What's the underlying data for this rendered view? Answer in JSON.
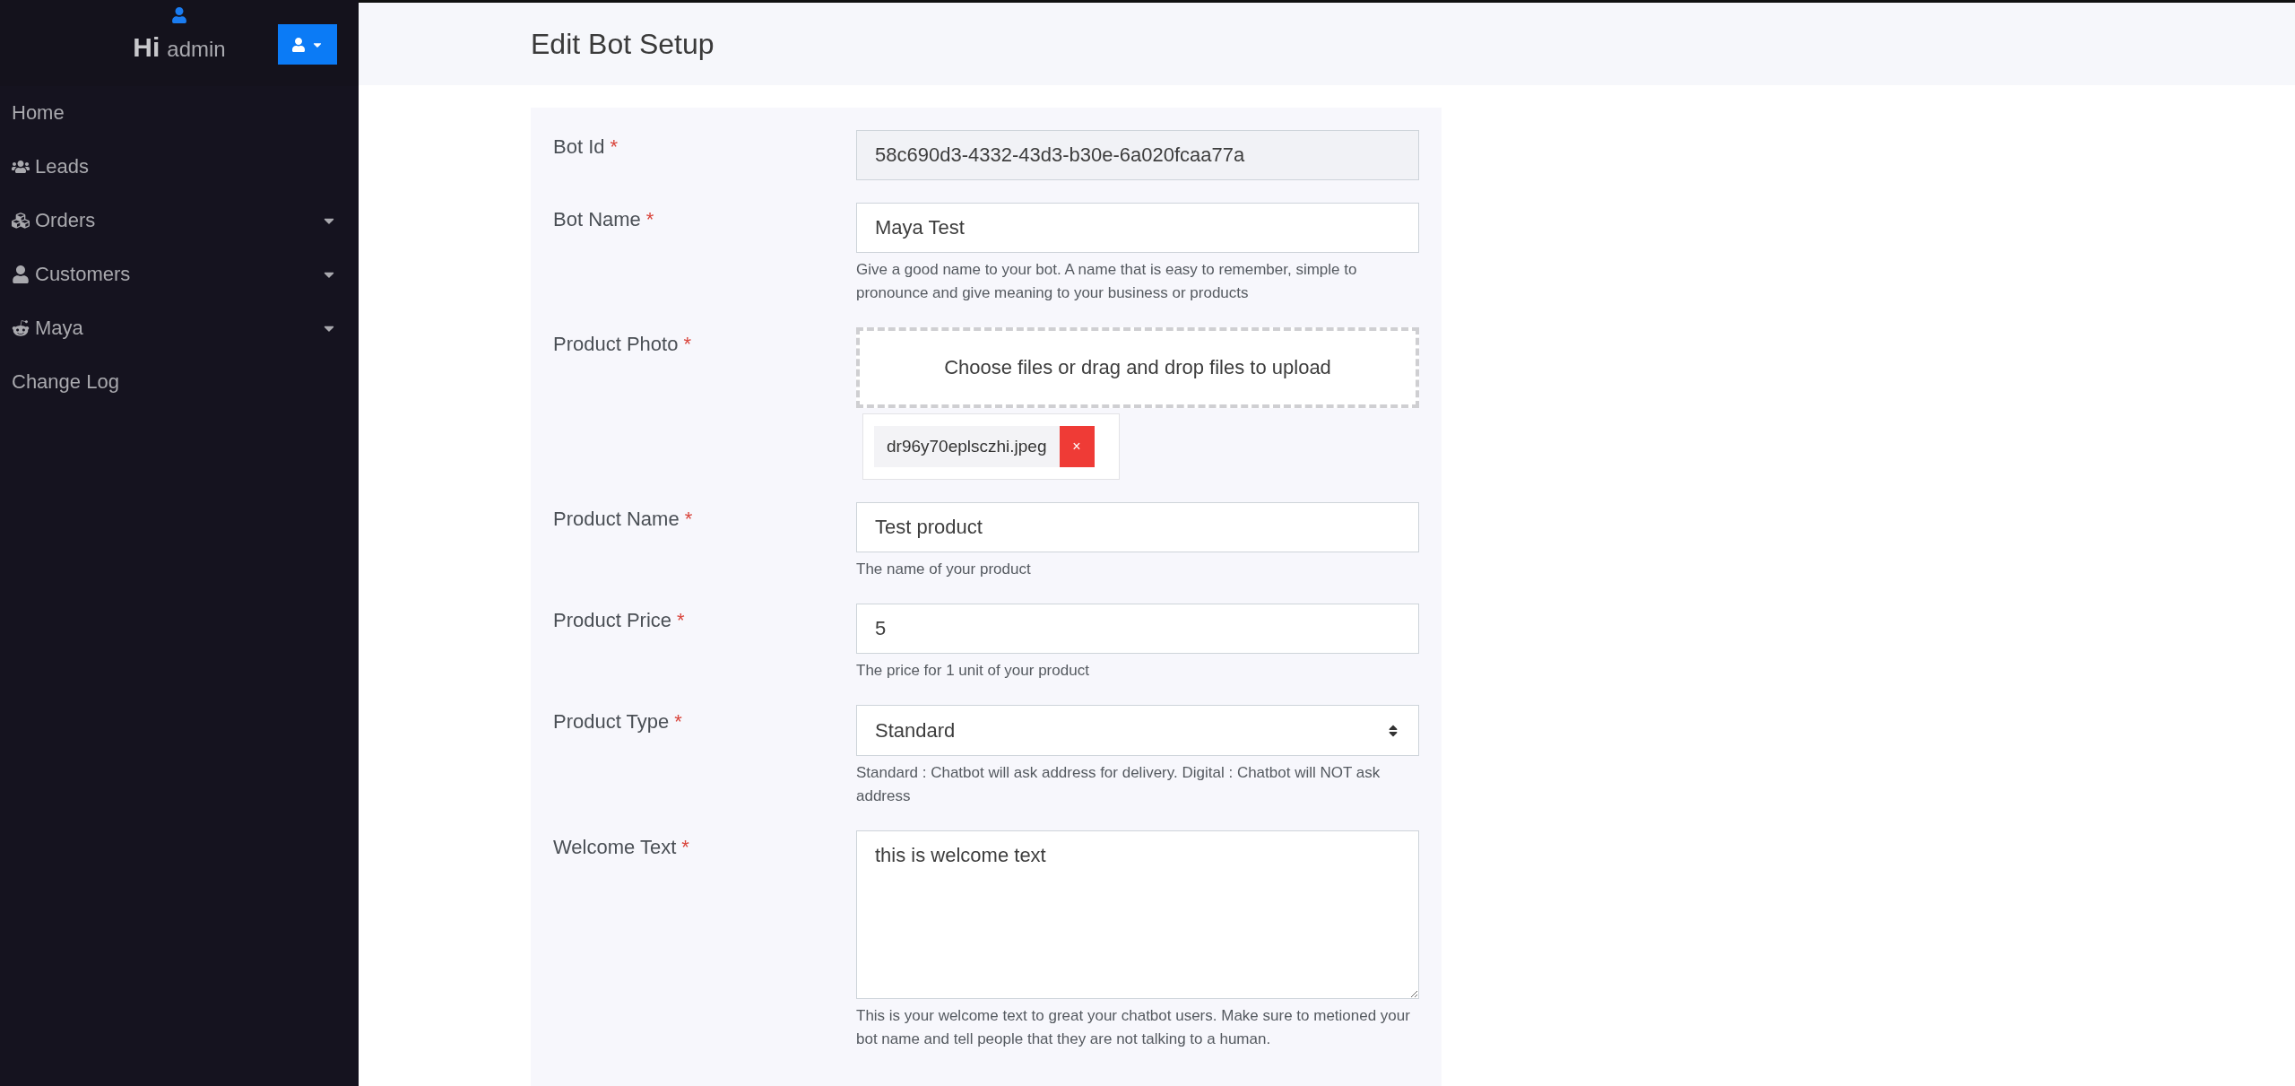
{
  "sidebar": {
    "greeting": "Hi",
    "username": "admin",
    "items": [
      {
        "label": "Home",
        "has_submenu": false
      },
      {
        "label": "Leads",
        "has_submenu": false
      },
      {
        "label": "Orders",
        "has_submenu": true
      },
      {
        "label": "Customers",
        "has_submenu": true
      },
      {
        "label": "Maya",
        "has_submenu": true
      },
      {
        "label": "Change Log",
        "has_submenu": false
      }
    ]
  },
  "page": {
    "title": "Edit Bot Setup"
  },
  "form": {
    "fields": [
      {
        "kind": "text",
        "label": "Bot Id",
        "required_mark": "*",
        "value": "58c690d3-4332-43d3-b30e-6a020fcaa77a",
        "disabled": true
      },
      {
        "kind": "text",
        "label": "Bot Name",
        "required_mark": "*",
        "value": "Maya Test",
        "disabled": false,
        "help": "Give a good name to your bot. A name that is easy to remember, simple to pronounce and give meaning to your business or products"
      },
      {
        "kind": "upload",
        "label": "Product Photo",
        "required_mark": "*",
        "prompt": "Choose files or drag and drop files to upload",
        "files": [
          {
            "name": "dr96y70eplsczhi.jpeg",
            "remove": "×"
          }
        ]
      },
      {
        "kind": "text",
        "label": "Product Name",
        "required_mark": "*",
        "value": "Test product",
        "disabled": false,
        "help": "The name of your product"
      },
      {
        "kind": "text",
        "label": "Product Price",
        "required_mark": "*",
        "value": "5",
        "disabled": false,
        "help": "The price for 1 unit of your product"
      },
      {
        "kind": "select",
        "label": "Product Type",
        "required_mark": "*",
        "value": "Standard",
        "help": "Standard : Chatbot will ask address for delivery. Digital : Chatbot will NOT ask address"
      },
      {
        "kind": "textarea",
        "label": "Welcome Text",
        "required_mark": "*",
        "value": "this is welcome text",
        "help": "This is your welcome text to great your chatbot users. Make sure to metioned your bot name and tell people that they are not talking to a human."
      }
    ]
  }
}
